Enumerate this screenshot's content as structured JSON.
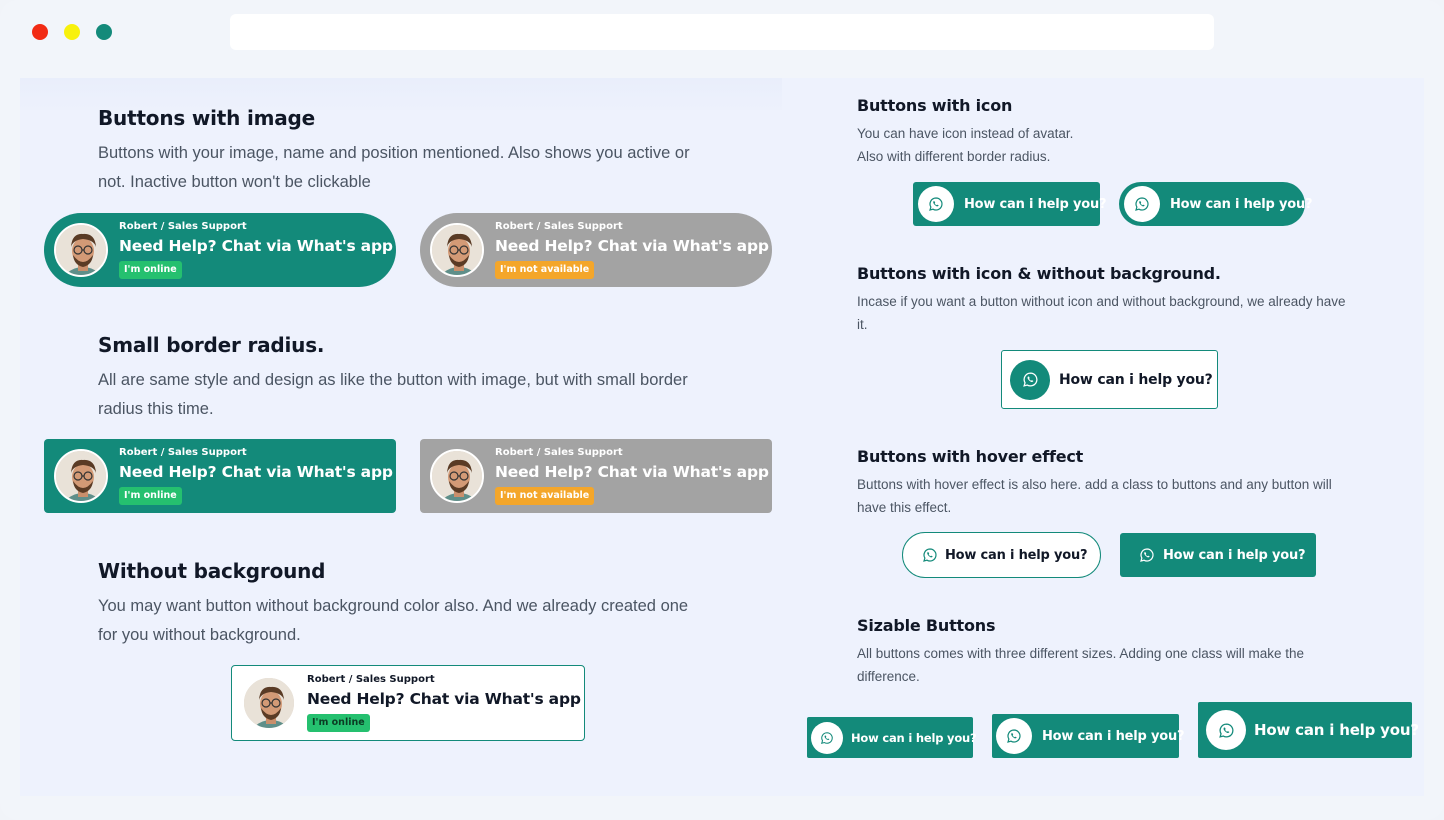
{
  "left": {
    "sections": [
      {
        "title": "Buttons with image",
        "desc_line1": "Buttons with your image, name and position mentioned. Also shows you active or",
        "desc_line2": "not. Inactive button won't be clickable"
      },
      {
        "title": "Small border radius.",
        "desc_line1": "All are same style and design as like the button with image, but with small border",
        "desc_line2": "radius this time."
      },
      {
        "title": "Without background",
        "desc_line1": "You may want button without background color also. And we already created one",
        "desc_line2": "for you without background."
      }
    ],
    "chat_button": {
      "role": "Robert / Sales Support",
      "title": "Need Help? Chat via What's app",
      "online": "I'm online",
      "offline": "I'm not available"
    }
  },
  "right": {
    "sections": [
      {
        "title": "Buttons with icon",
        "desc_line1": "You can have icon instead of avatar.",
        "desc_line2": "Also with different border radius."
      },
      {
        "title": "Buttons with icon & without background.",
        "desc_line1": "Incase if you want a button without icon and without background, we already have",
        "desc_line2": "it."
      },
      {
        "title": "Buttons with hover effect",
        "desc_line1": "Buttons with hover effect is also here. add a class to buttons and any button will",
        "desc_line2": "have this effect."
      },
      {
        "title": "Sizable Buttons",
        "desc_line1": "All buttons comes with three different sizes. Adding one class will make the",
        "desc_line2": "difference."
      }
    ],
    "help_label": "How can i help you?"
  },
  "colors": {
    "brand": "#138a7a",
    "inactive": "#a3a3a3",
    "online_badge": "#25c06f",
    "away_badge": "#f4a62a"
  },
  "icons": {
    "chat": "whatsapp-icon",
    "avatar": "avatar-photo"
  }
}
